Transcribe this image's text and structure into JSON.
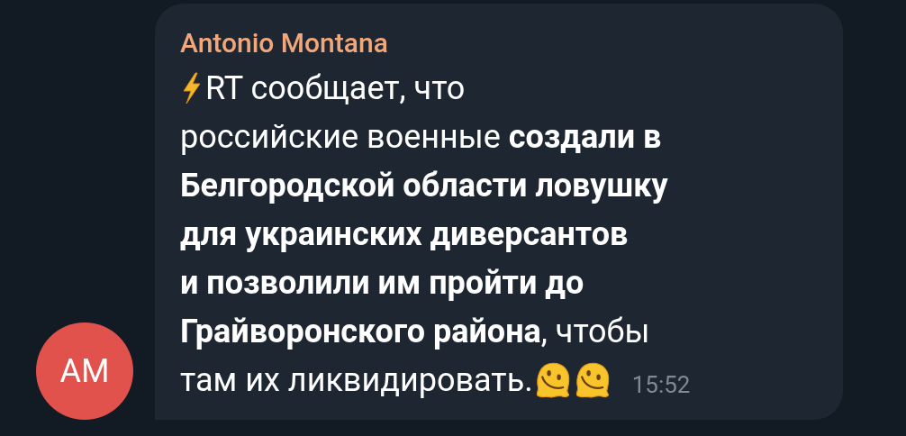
{
  "message": {
    "sender": "Antonio Montana",
    "lines": [
      "RT сообщает, что",
      "российские военные **создали в**",
      "**Белгородской области ловушку**",
      "**для украинских диверсантов**",
      "**и позволили им пройти до**",
      "**Грайворонского района**, чтобы",
      "там их ликвидировать."
    ],
    "time": "15:52"
  },
  "avatar": {
    "initials": "AM",
    "color": "#e0524b"
  }
}
